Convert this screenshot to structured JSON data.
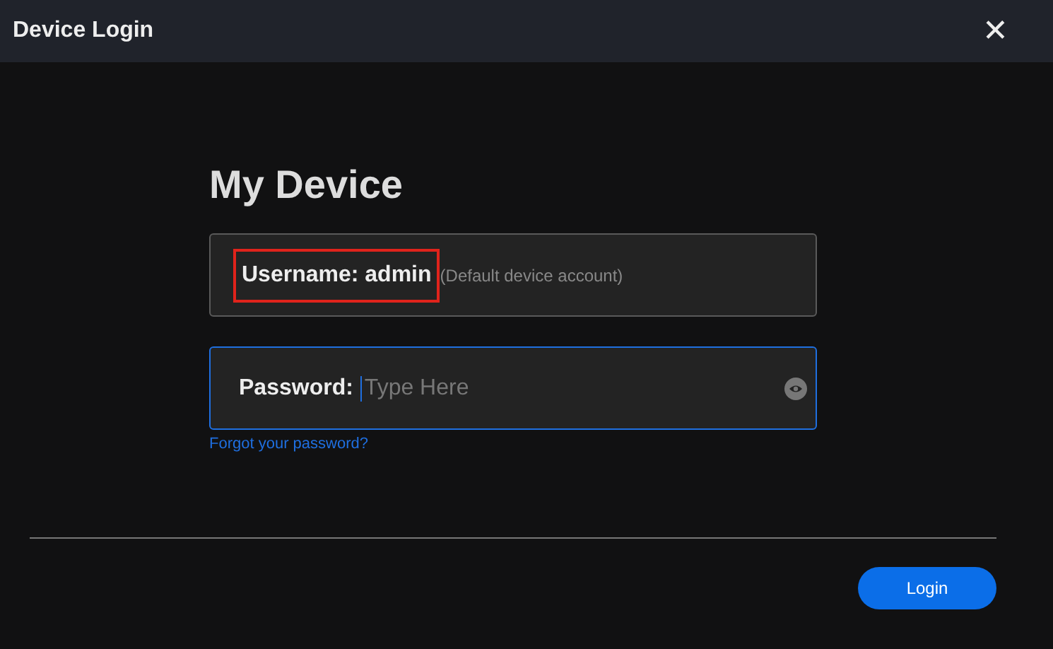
{
  "window": {
    "title": "Device Login",
    "close": "✕"
  },
  "heading": "My Device",
  "username": {
    "label": "Username:",
    "value": "admin",
    "note": "(Default device account)",
    "highlighted": true
  },
  "password": {
    "label": "Password:",
    "placeholder": "Type Here",
    "focused": true
  },
  "forgot_link": "Forgot your password?",
  "buttons": [
    "Login"
  ]
}
